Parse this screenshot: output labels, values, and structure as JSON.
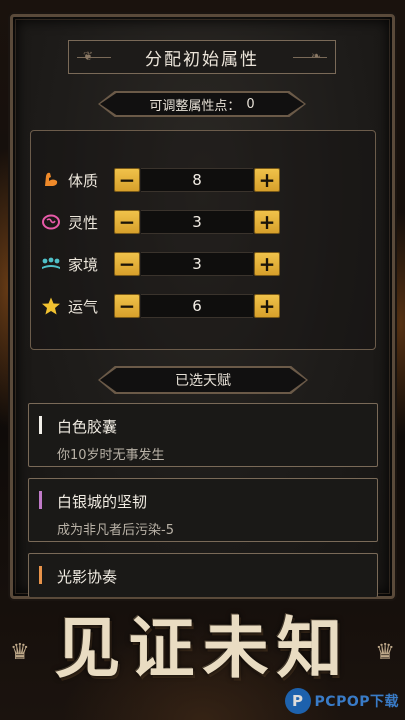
{
  "title": "分配初始属性",
  "points": {
    "label": "可调整属性点：",
    "value": "0"
  },
  "attributes": [
    {
      "name": "体质",
      "value": "8",
      "icon": "arm-muscle-icon",
      "icon_color": "#ef8a2a"
    },
    {
      "name": "灵性",
      "value": "3",
      "icon": "brain-icon",
      "icon_color": "#e75aa8"
    },
    {
      "name": "家境",
      "value": "3",
      "icon": "coins-icon",
      "icon_color": "#4fc0c8"
    },
    {
      "name": "运气",
      "value": "6",
      "icon": "star-icon",
      "icon_color": "#f2c230"
    }
  ],
  "controls": {
    "minus": "−",
    "plus": "+"
  },
  "talents_header": "已选天赋",
  "talents": [
    {
      "name": "白色胶囊",
      "desc": "你10岁时无事发生",
      "bar_color": "#f2efe9"
    },
    {
      "name": "白银城的坚韧",
      "desc": "成为非凡者后污染-5",
      "bar_color": "#c07ac8"
    },
    {
      "name": "光影协奏",
      "desc": "",
      "bar_color": "#e8934a"
    }
  ],
  "slogan": "见证未知",
  "watermark": {
    "icon": "P",
    "text": "PCPOP下载"
  },
  "colors": {
    "button_gold": "#e2ad36",
    "frame": "#6c5c4b"
  }
}
